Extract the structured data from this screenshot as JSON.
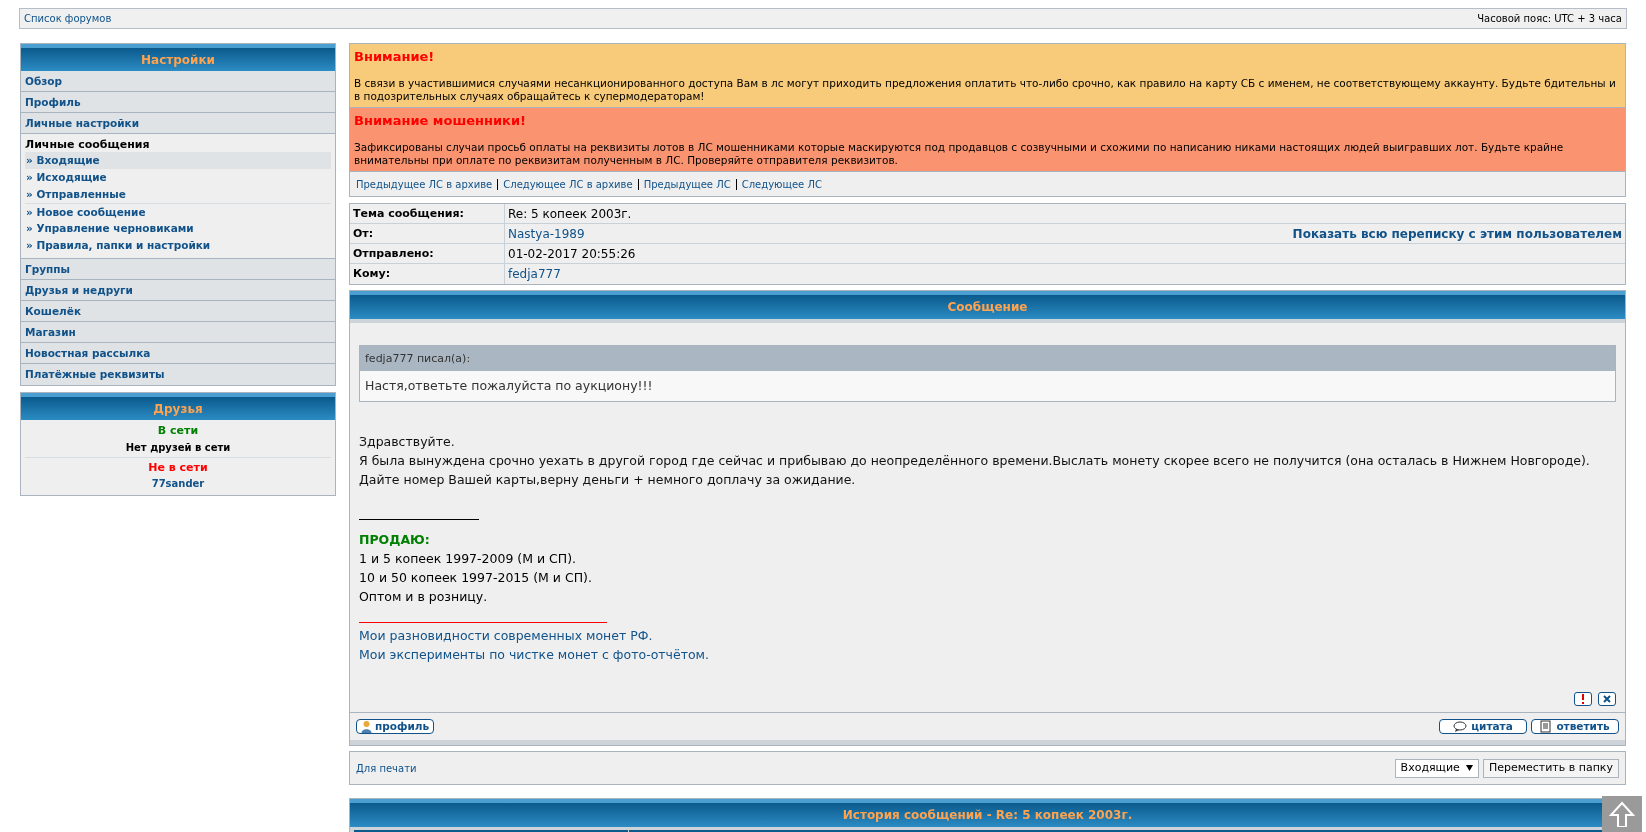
{
  "top_bar": {
    "forum_list_link": "Список форумов",
    "timezone": "Часовой пояс: UTC + 3 часа"
  },
  "sidebar": {
    "title": "Настройки",
    "items": [
      {
        "label": "Обзор",
        "kind": "link"
      },
      {
        "label": "Профиль",
        "kind": "link"
      },
      {
        "label": "Личные настройки",
        "kind": "link"
      },
      {
        "label": "Личные сообщения",
        "kind": "group",
        "children": [
          {
            "label": "» Входящие",
            "selected": true
          },
          {
            "label": "» Исходящие",
            "selected": false
          },
          {
            "label": "» Отправленные",
            "selected": false
          },
          {
            "label": "» Новое сообщение",
            "selected": false,
            "separator": true
          },
          {
            "label": "» Управление черновиками",
            "selected": false
          },
          {
            "label": "» Правила, папки и настройки",
            "selected": false
          }
        ]
      },
      {
        "label": "Группы",
        "kind": "link"
      },
      {
        "label": "Друзья и недруги",
        "kind": "link"
      },
      {
        "label": "Кошелёк",
        "kind": "link"
      },
      {
        "label": "Магазин",
        "kind": "link"
      },
      {
        "label": "Новостная рассылка",
        "kind": "link"
      },
      {
        "label": "Платёжные реквизиты",
        "kind": "link"
      }
    ]
  },
  "friends": {
    "title": "Друзья",
    "online_label": "В сети",
    "online_empty": "Нет друзей в сети",
    "offline_label": "Не в сети",
    "offline": [
      "77sander"
    ]
  },
  "notices": [
    {
      "title": "Внимание!",
      "text": "В связи в участившимися случаями несанкционированного доступа Вам в лс могут приходить предложения оплатить что-либо срочно, как правило на карту СБ с именем, не соответствующему аккаунту. Будьте бдительны и в подозрительных случаях обращайтесь к супермодераторам!",
      "color": "#f8cb7b"
    },
    {
      "title": "Внимание мошенники!",
      "text": "Зафиксированы случаи просьб оплаты на реквизиты лотов в ЛС мошенниками которые маскируются под продавцов с созвучными и схожими по написанию никами настоящих людей выигравших лот. Будьте крайне внимательны при оплате по реквизитам полученным в ЛС. Проверяйте отправителя реквизитов.",
      "color": "#fa9470"
    }
  ],
  "nav_links": [
    "Предыдущее ЛС в архиве",
    "Следующее ЛС в архиве",
    "Предыдущее ЛС",
    "Следующее ЛС"
  ],
  "header_rows": [
    {
      "label": "Тема сообщения:",
      "value": "Re: 5 копеек 2003г.",
      "kind": "text"
    },
    {
      "label": "От:",
      "value": "Nastya-1989",
      "kind": "link",
      "action": "Показать всю переписку с этим пользователем"
    },
    {
      "label": "Отправлено:",
      "value": "01-02-2017 20:55:26",
      "kind": "text"
    },
    {
      "label": "Кому:",
      "value": "fedja777",
      "kind": "link"
    }
  ],
  "message": {
    "title": "Сообщение",
    "quote": {
      "author": "fedja777 писал(а):",
      "text": "Настя,ответьте пожалуйста по аукциону!!!"
    },
    "lines": [
      "Здравствуйте.",
      "Я была вынуждена срочно уехать в другой город где сейчас и прибываю до неопределённого времени.Выслать монету скорее всего не получится (она осталась в Нижнем Новгороде).",
      "Дайте номер Вашей карты,верну деньги + немного доплачу за ожидание."
    ],
    "signature": {
      "heading": "ПРОДАЮ:",
      "lines": [
        "1 и 5 копеек 1997-2009 (М и СП).",
        "10 и 50 копеек 1997-2015 (М и СП).",
        "Оптом и в розницу."
      ],
      "links": [
        "Мои разновидности современных монет РФ.",
        "Мои эксперименты по чистке монет с фото-отчётом."
      ]
    },
    "profile_button": "профиль",
    "quote_button": "цитата",
    "reply_button": "ответить"
  },
  "actions": {
    "print_link": "Для печати",
    "folder_select": "Входящие",
    "move_button": "Переместить в папку"
  },
  "history": {
    "title": "История сообщений - Re: 5 копеек 2003г."
  }
}
